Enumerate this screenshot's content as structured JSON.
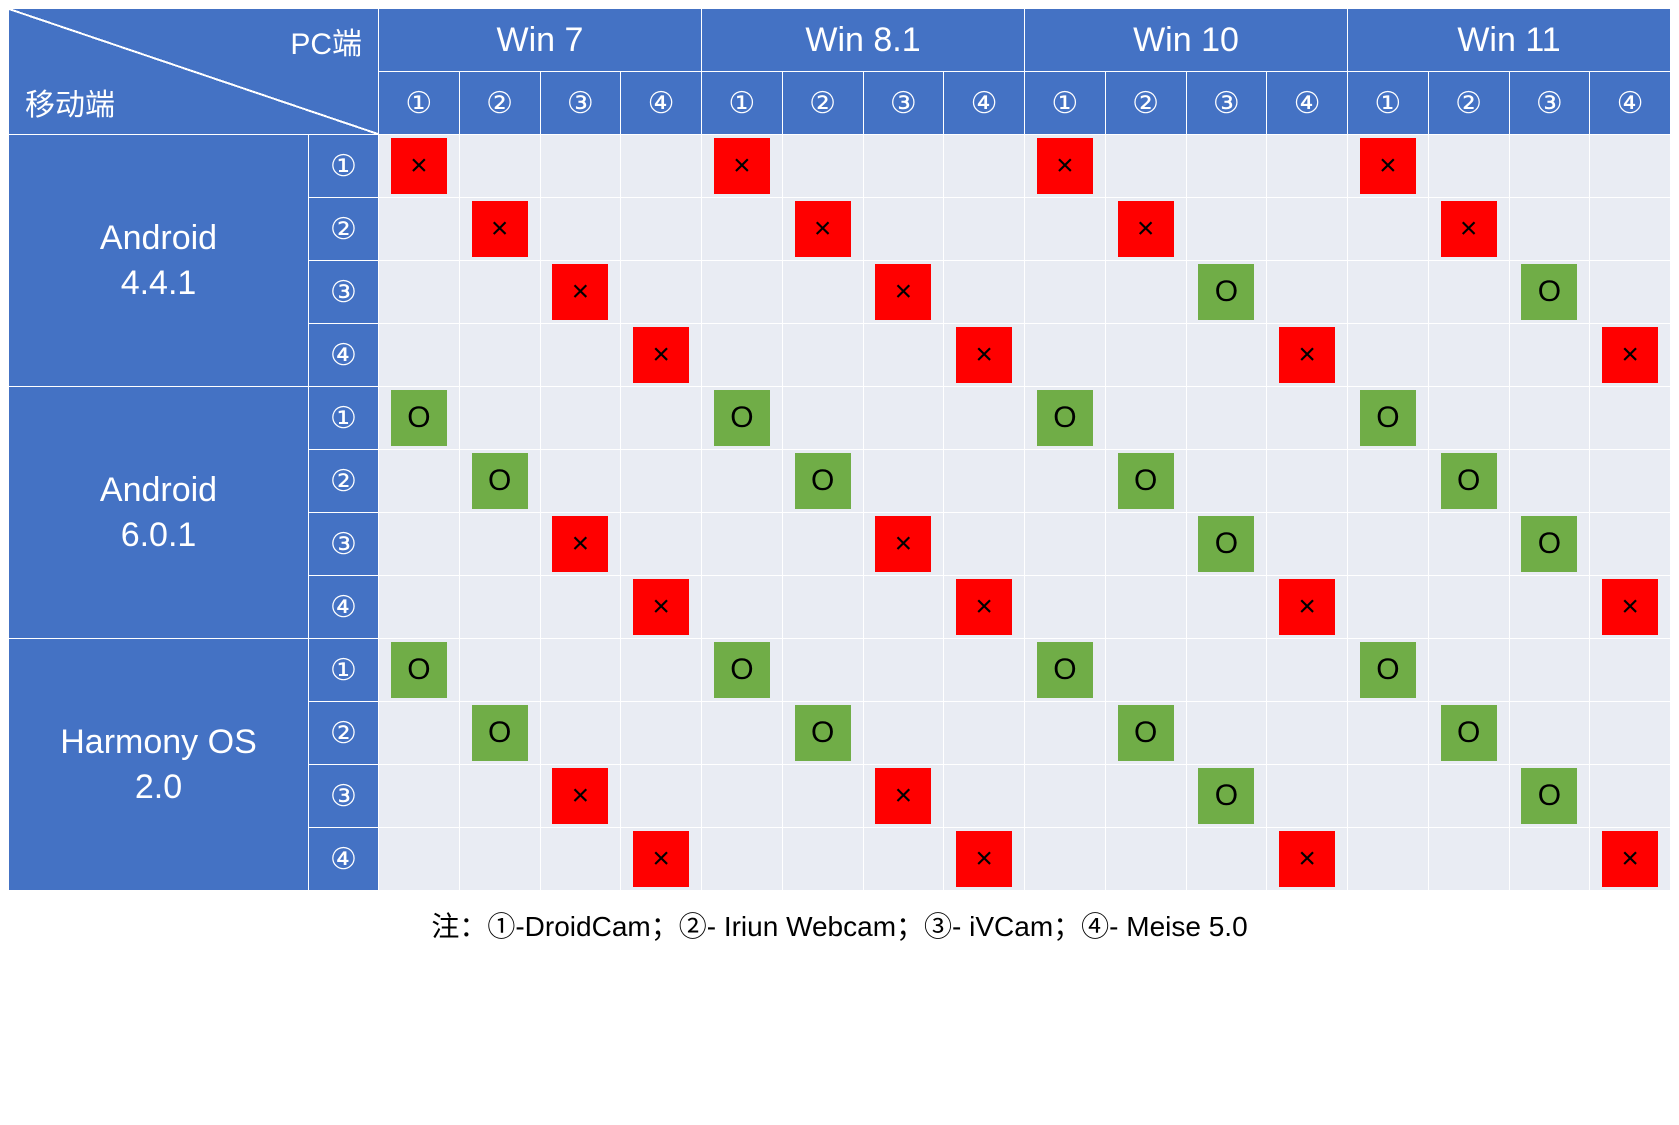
{
  "header": {
    "pc_label": "PC端",
    "mobile_label": "移动端"
  },
  "pc_groups": [
    {
      "label": "Win 7",
      "subs": [
        "①",
        "②",
        "③",
        "④"
      ]
    },
    {
      "label": "Win 8.1",
      "subs": [
        "①",
        "②",
        "③",
        "④"
      ]
    },
    {
      "label": "Win 10",
      "subs": [
        "①",
        "②",
        "③",
        "④"
      ]
    },
    {
      "label": "Win 11",
      "subs": [
        "①",
        "②",
        "③",
        "④"
      ]
    }
  ],
  "mobile_groups": [
    {
      "label": "Android\n4.4.1",
      "subs": [
        "①",
        "②",
        "③",
        "④"
      ]
    },
    {
      "label": "Android\n6.0.1",
      "subs": [
        "①",
        "②",
        "③",
        "④"
      ]
    },
    {
      "label": "Harmony OS\n2.0",
      "subs": [
        "①",
        "②",
        "③",
        "④"
      ]
    }
  ],
  "legend_note": "注：①-DroidCam；②- Iriun Webcam；③- iVCam；④- Meise 5.0",
  "symbols": {
    "fail": "×",
    "pass": "O"
  },
  "chart_data": {
    "type": "heatmap",
    "title": "",
    "xlabel": "PC端",
    "ylabel": "移动端",
    "pc_os": [
      "Win 7",
      "Win 8.1",
      "Win 10",
      "Win 11"
    ],
    "mobile_os": [
      "Android 4.4.1",
      "Android 6.0.1",
      "Harmony OS 2.0"
    ],
    "apps": [
      "DroidCam",
      "Iriun Webcam",
      "iVCam",
      "Meise 5.0"
    ],
    "app_symbols": [
      "①",
      "②",
      "③",
      "④"
    ],
    "result_legend": {
      "fail": "×",
      "pass": "O",
      "blank": ""
    },
    "grid_meaning": "grid[mobile_os_index][mobile_app_index][pc_os_index][pc_app_index] = 'fail'|'pass'|'' ; only diagonal (same app on both ends) is populated",
    "grid": [
      [
        [
          [
            "fail",
            "",
            "",
            ""
          ],
          [
            "fail",
            "",
            "",
            ""
          ],
          [
            "fail",
            "",
            "",
            ""
          ],
          [
            "fail",
            "",
            "",
            ""
          ]
        ],
        [
          [
            "",
            "fail",
            "",
            ""
          ],
          [
            "",
            "fail",
            "",
            ""
          ],
          [
            "",
            "fail",
            "",
            ""
          ],
          [
            "",
            "fail",
            "",
            ""
          ]
        ],
        [
          [
            "",
            "",
            "fail",
            ""
          ],
          [
            "",
            "",
            "fail",
            ""
          ],
          [
            "",
            "",
            "pass",
            ""
          ],
          [
            "",
            "",
            "pass",
            ""
          ]
        ],
        [
          [
            "",
            "",
            "",
            "fail"
          ],
          [
            "",
            "",
            "",
            "fail"
          ],
          [
            "",
            "",
            "",
            "fail"
          ],
          [
            "",
            "",
            "",
            "fail"
          ]
        ]
      ],
      [
        [
          [
            "pass",
            "",
            "",
            ""
          ],
          [
            "pass",
            "",
            "",
            ""
          ],
          [
            "pass",
            "",
            "",
            ""
          ],
          [
            "pass",
            "",
            "",
            ""
          ]
        ],
        [
          [
            "",
            "pass",
            "",
            ""
          ],
          [
            "",
            "pass",
            "",
            ""
          ],
          [
            "",
            "pass",
            "",
            ""
          ],
          [
            "",
            "pass",
            "",
            ""
          ]
        ],
        [
          [
            "",
            "",
            "fail",
            ""
          ],
          [
            "",
            "",
            "fail",
            ""
          ],
          [
            "",
            "",
            "pass",
            ""
          ],
          [
            "",
            "",
            "pass",
            ""
          ]
        ],
        [
          [
            "",
            "",
            "",
            "fail"
          ],
          [
            "",
            "",
            "",
            "fail"
          ],
          [
            "",
            "",
            "",
            "fail"
          ],
          [
            "",
            "",
            "",
            "fail"
          ]
        ]
      ],
      [
        [
          [
            "pass",
            "",
            "",
            ""
          ],
          [
            "pass",
            "",
            "",
            ""
          ],
          [
            "pass",
            "",
            "",
            ""
          ],
          [
            "pass",
            "",
            "",
            ""
          ]
        ],
        [
          [
            "",
            "pass",
            "",
            ""
          ],
          [
            "",
            "pass",
            "",
            ""
          ],
          [
            "",
            "pass",
            "",
            ""
          ],
          [
            "",
            "pass",
            "",
            ""
          ]
        ],
        [
          [
            "",
            "",
            "fail",
            ""
          ],
          [
            "",
            "",
            "fail",
            ""
          ],
          [
            "",
            "",
            "pass",
            ""
          ],
          [
            "",
            "",
            "pass",
            ""
          ]
        ],
        [
          [
            "",
            "",
            "",
            "fail"
          ],
          [
            "",
            "",
            "",
            "fail"
          ],
          [
            "",
            "",
            "",
            "fail"
          ],
          [
            "",
            "",
            "",
            "fail"
          ]
        ]
      ]
    ]
  }
}
